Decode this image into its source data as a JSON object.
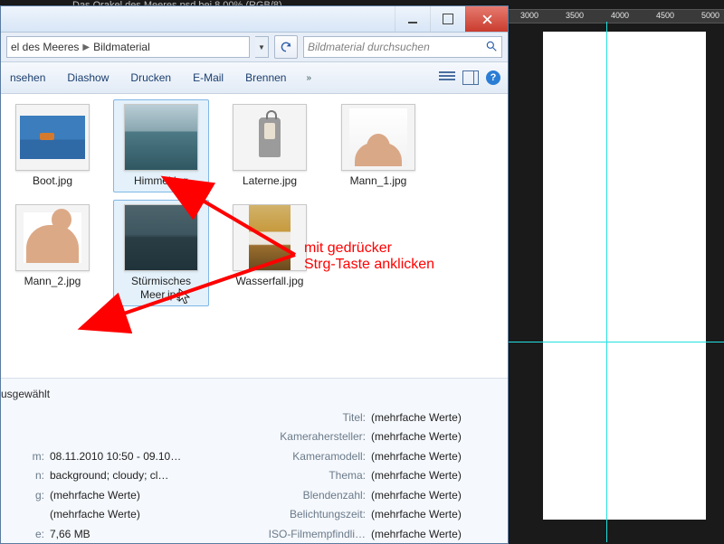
{
  "ps": {
    "tab_title": "Das Orakel des Meeres.psd bei 8,00% (RGB/8)",
    "ruler_marks": [
      "3000",
      "3500",
      "4000",
      "4500",
      "5000"
    ]
  },
  "window": {
    "min_tip": "Minimieren",
    "max_tip": "Maximieren",
    "close_tip": "Schließen"
  },
  "breadcrumb": {
    "part1": "el des Meeres",
    "part2": "Bildmaterial"
  },
  "search": {
    "placeholder": "Bildmaterial durchsuchen"
  },
  "commands": {
    "ansehen": "nsehen",
    "diashow": "Diashow",
    "drucken": "Drucken",
    "email": "E-Mail",
    "brennen": "Brennen"
  },
  "files": [
    {
      "name": "Boot.jpg",
      "selected": false,
      "thumb": "boot"
    },
    {
      "name": "Himmel.jpg",
      "selected": true,
      "thumb": "himmel"
    },
    {
      "name": "Laterne.jpg",
      "selected": false,
      "thumb": "laterne"
    },
    {
      "name": "Mann_1.jpg",
      "selected": false,
      "thumb": "mann1"
    },
    {
      "name": "Mann_2.jpg",
      "selected": false,
      "thumb": "mann2"
    },
    {
      "name": "Stürmisches Meer.jpg",
      "selected": true,
      "thumb": "meer"
    },
    {
      "name": "Wasserfall.jpg",
      "selected": false,
      "thumb": "wasserfall"
    }
  ],
  "annotation": {
    "line1": "mit gedrücker",
    "line2": "Strg-Taste anklicken"
  },
  "details": {
    "header": "usgewählt",
    "multi": "(mehrfache Werte)",
    "left": {
      "m_label": "m:",
      "m_value": "08.11.2010 10:50 - 09.10…",
      "n_label": "n:",
      "n_value": "background; cloudy; cl…",
      "g_label": "g:",
      "e_label": "e:",
      "e_value": "7,66 MB"
    },
    "right_labels": {
      "titel": "Titel:",
      "kamerahersteller": "Kamerahersteller:",
      "kameramodell": "Kameramodell:",
      "thema": "Thema:",
      "blendenzahl": "Blendenzahl:",
      "belichtungszeit": "Belichtungszeit:",
      "iso": "ISO-Filmempfindli…"
    }
  }
}
